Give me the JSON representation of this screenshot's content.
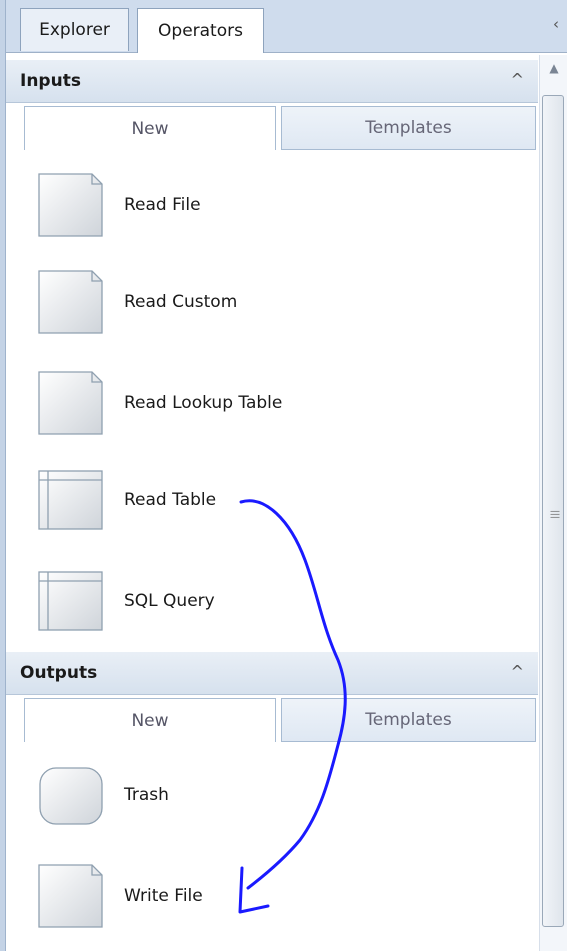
{
  "tabs": [
    {
      "label": "Explorer",
      "active": false
    },
    {
      "label": "Operators",
      "active": true
    }
  ],
  "sections": [
    {
      "title": "Inputs",
      "subtabs": {
        "new": "New",
        "templates": "Templates"
      },
      "items": [
        {
          "label": "Read File",
          "icon": "document-icon"
        },
        {
          "label": "Read Custom",
          "icon": "document-icon"
        },
        {
          "label": "Read Lookup Table",
          "icon": "document-icon"
        },
        {
          "label": "Read Table",
          "icon": "table-icon"
        },
        {
          "label": "SQL Query",
          "icon": "table-icon"
        }
      ]
    },
    {
      "title": "Outputs",
      "subtabs": {
        "new": "New",
        "templates": "Templates"
      },
      "items": [
        {
          "label": "Trash",
          "icon": "rounded-box-icon"
        },
        {
          "label": "Write File",
          "icon": "document-icon"
        }
      ]
    }
  ],
  "colors": {
    "annotation": "#1a1aff",
    "header_bg": "#d6e1ee",
    "border": "#8ea3bd"
  }
}
